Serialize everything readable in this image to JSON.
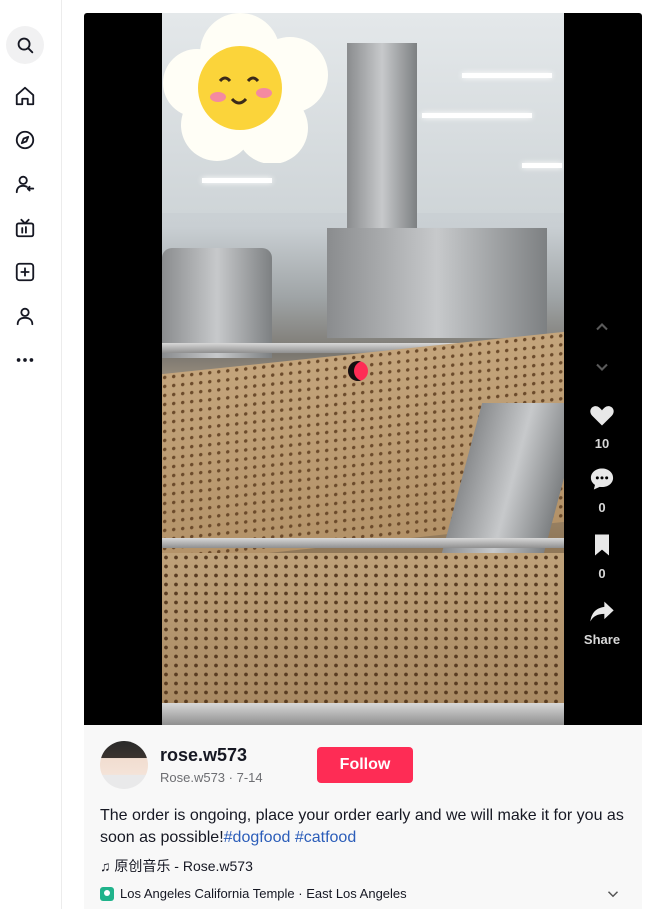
{
  "sidebar": {
    "items": [
      {
        "name": "search-icon"
      },
      {
        "name": "home-icon"
      },
      {
        "name": "explore-icon"
      },
      {
        "name": "following-icon"
      },
      {
        "name": "live-icon"
      },
      {
        "name": "upload-icon"
      },
      {
        "name": "profile-icon"
      },
      {
        "name": "more-icon"
      }
    ]
  },
  "video": {
    "actions": {
      "like_count": "10",
      "comment_count": "0",
      "favorite_count": "0",
      "share_label": "Share"
    }
  },
  "post": {
    "username": "rose.w573",
    "handle": "Rose.w573",
    "date": "7-14",
    "separator": " · ",
    "follow_label": "Follow",
    "caption_text": "The order is ongoing, place your order early and we will make it for you as soon as possible!",
    "hashtags": [
      "#dogfood",
      "#catfood"
    ],
    "music": "♫ 原创音乐 - Rose.w573",
    "location": "Los Angeles California Temple · East Los Angeles"
  },
  "colors": {
    "accent": "#fe2c55",
    "hashtag": "#2b5db9",
    "location_icon": "#20b38b"
  }
}
